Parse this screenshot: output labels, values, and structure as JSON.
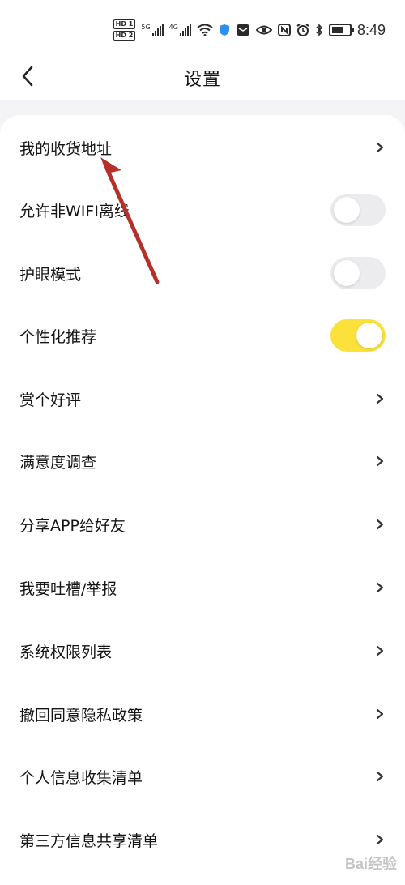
{
  "status": {
    "hd1": "HD 1",
    "hd2": "HD 2",
    "net1": "5G",
    "net2": "4G",
    "time": "8:49"
  },
  "header": {
    "title": "设置"
  },
  "settings": {
    "items": [
      {
        "label": "我的收货地址",
        "type": "link"
      },
      {
        "label": "允许非WIFI离线",
        "type": "toggle",
        "on": false
      },
      {
        "label": "护眼模式",
        "type": "toggle",
        "on": false
      },
      {
        "label": "个性化推荐",
        "type": "toggle",
        "on": true
      },
      {
        "label": "赏个好评",
        "type": "link"
      },
      {
        "label": "满意度调查",
        "type": "link"
      },
      {
        "label": "分享APP给好友",
        "type": "link"
      },
      {
        "label": "我要吐槽/举报",
        "type": "link"
      },
      {
        "label": "系统权限列表",
        "type": "link"
      },
      {
        "label": "撤回同意隐私政策",
        "type": "link"
      },
      {
        "label": "个人信息收集清单",
        "type": "link"
      },
      {
        "label": "第三方信息共享清单",
        "type": "link"
      }
    ]
  },
  "colors": {
    "toggle_on": "#fbe13a",
    "toggle_off": "#ececee",
    "annotation_arrow": "#b5302a"
  },
  "watermark": {
    "text": "Bai经验"
  }
}
